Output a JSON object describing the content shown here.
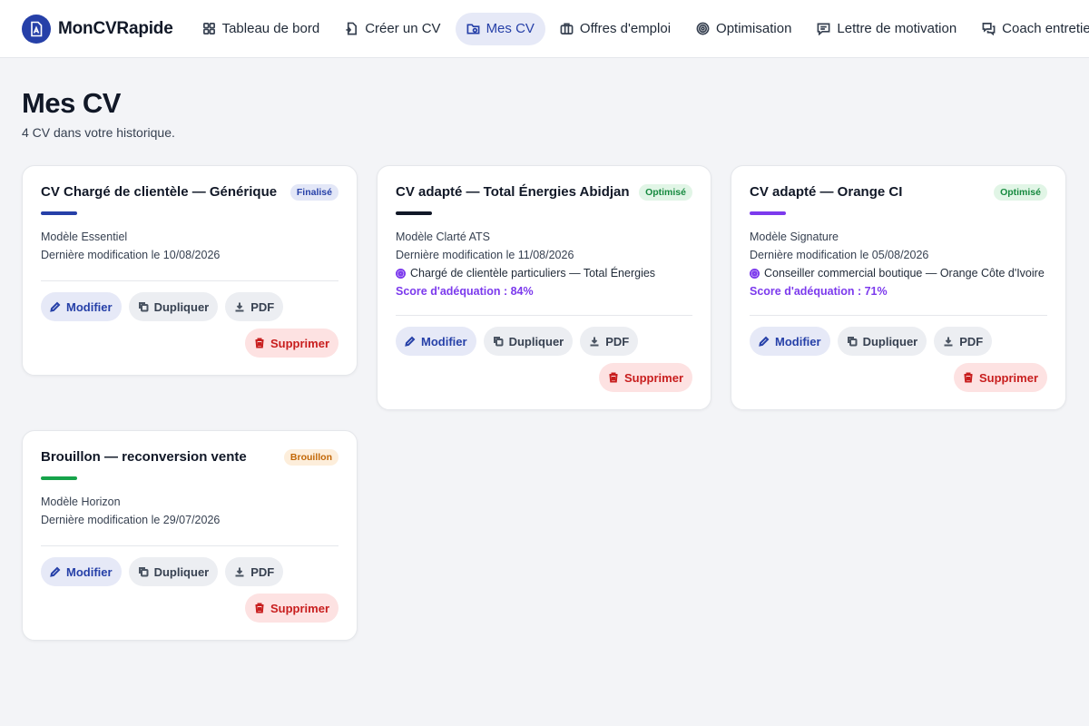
{
  "app": {
    "name": "MonCVRapide",
    "brand_color": "#2640a8"
  },
  "nav": [
    {
      "label": "Tableau de bord",
      "icon": "dashboard-icon",
      "active": false
    },
    {
      "label": "Créer un CV",
      "icon": "file-plus-icon",
      "active": false
    },
    {
      "label": "Mes CV",
      "icon": "folder-icon",
      "active": true
    },
    {
      "label": "Offres d'emploi",
      "icon": "briefcase-icon",
      "active": false
    },
    {
      "label": "Optimisation",
      "icon": "target-icon",
      "active": false
    },
    {
      "label": "Lettre de motivation",
      "icon": "message-icon",
      "active": false
    },
    {
      "label": "Coach entretien",
      "icon": "chat-icon",
      "active": false
    }
  ],
  "page": {
    "title": "Mes CV",
    "subtitle": "4 CV dans votre historique."
  },
  "actions": {
    "edit": "Modifier",
    "duplicate": "Dupliquer",
    "pdf": "PDF",
    "delete": "Supprimer"
  },
  "cards": [
    {
      "title": "CV Chargé de clientèle — Générique",
      "status": "Finalisé",
      "accent": "#2640a8",
      "template": "Modèle Essentiel",
      "modified": "Dernière modification le 10/08/2026"
    },
    {
      "title": "CV adapté — Total Énergies Abidjan",
      "status": "Optimisé",
      "accent": "#111827",
      "template": "Modèle Clarté ATS",
      "modified": "Dernière modification le 11/08/2026",
      "target": "Chargé de clientèle particuliers — Total Énergies",
      "score": "Score d'adéquation : 84%"
    },
    {
      "title": "CV adapté — Orange CI",
      "status": "Optimisé",
      "accent": "#7c3aed",
      "template": "Modèle Signature",
      "modified": "Dernière modification le 05/08/2026",
      "target": "Conseiller commercial boutique — Orange Côte d'Ivoire",
      "score": "Score d'adéquation : 71%"
    },
    {
      "title": "Brouillon — reconversion vente",
      "status": "Brouillon",
      "accent": "#16a34a",
      "template": "Modèle Horizon",
      "modified": "Dernière modification le 29/07/2026"
    }
  ]
}
